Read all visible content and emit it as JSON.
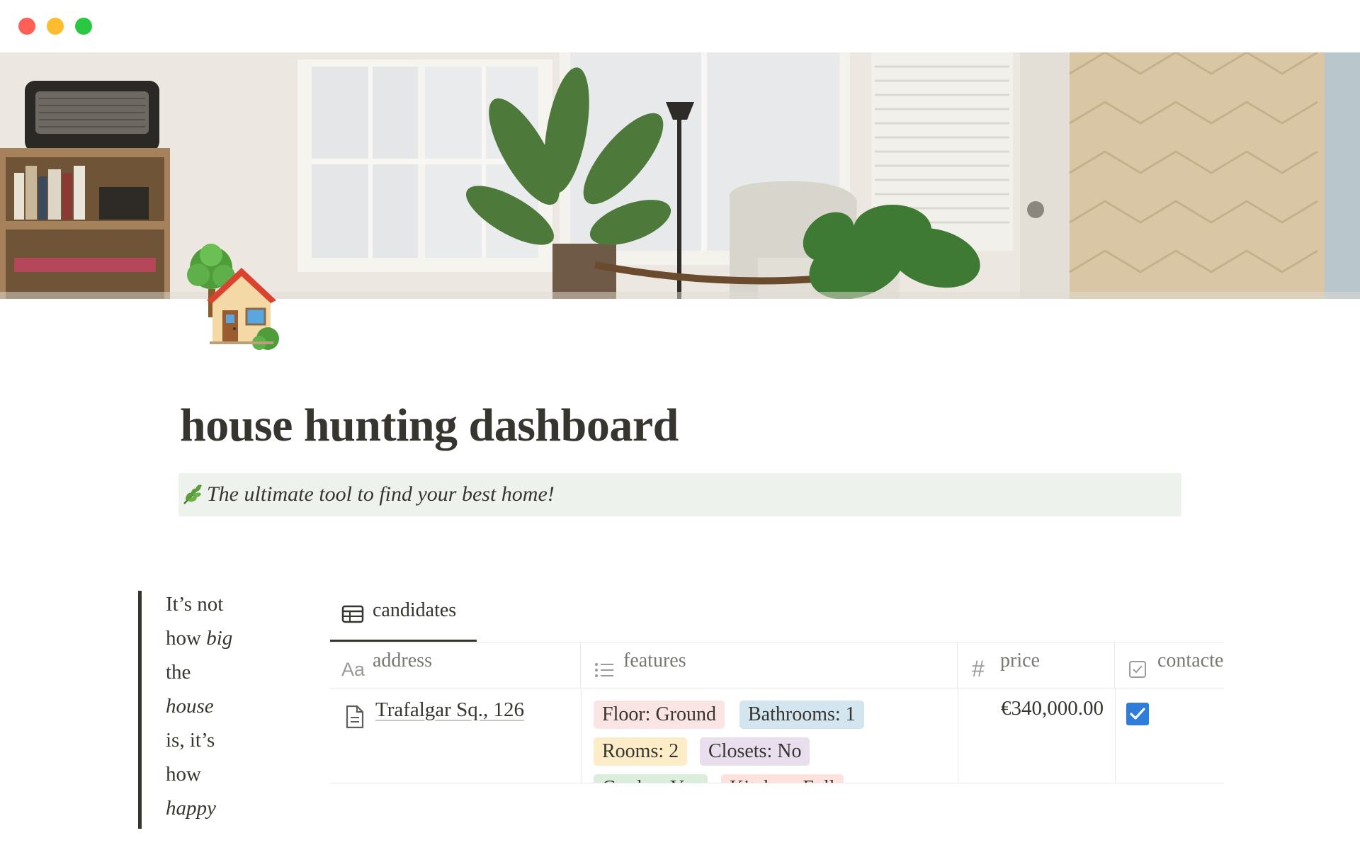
{
  "page": {
    "title": "house hunting dashboard",
    "callout_text": "The ultimate tool to find your best home!",
    "page_icon": "house-with-garden-icon",
    "callout_icon": "herb-icon"
  },
  "quote": {
    "lines": [
      {
        "pre": "It’s not",
        "em": ""
      },
      {
        "pre": "how ",
        "em": "big"
      },
      {
        "pre": "the",
        "em": ""
      },
      {
        "pre": "",
        "em": "house"
      },
      {
        "pre": "is, it’s",
        "em": ""
      },
      {
        "pre": "how",
        "em": ""
      },
      {
        "pre": "",
        "em": "happy"
      }
    ]
  },
  "database": {
    "view_tab": "candidates",
    "columns": {
      "address": {
        "icon": "Aa",
        "label": "address"
      },
      "features": {
        "label": "features"
      },
      "price": {
        "icon": "#",
        "label": "price"
      },
      "contacted": {
        "label": "contacted"
      }
    },
    "rows": [
      {
        "address": "Trafalgar Sq., 126",
        "features": [
          {
            "label": "Floor: Ground",
            "color": "#fbe4e4"
          },
          {
            "label": "Bathrooms: 1",
            "color": "#d3e5ef"
          },
          {
            "label": "Rooms: 2",
            "color": "#fdecc8"
          },
          {
            "label": "Closets: No",
            "color": "#e8deee"
          },
          {
            "label": "Garden: Yes",
            "color": "#dbeddb"
          },
          {
            "label": "Kitchen: Full",
            "color": "#ffe2dd"
          }
        ],
        "price": "€340,000.00",
        "contacted": true
      }
    ]
  },
  "colors": {
    "text": "#37352f",
    "muted": "#787774",
    "callout_bg": "#edf3ec",
    "checkbox": "#2f7cdb"
  }
}
